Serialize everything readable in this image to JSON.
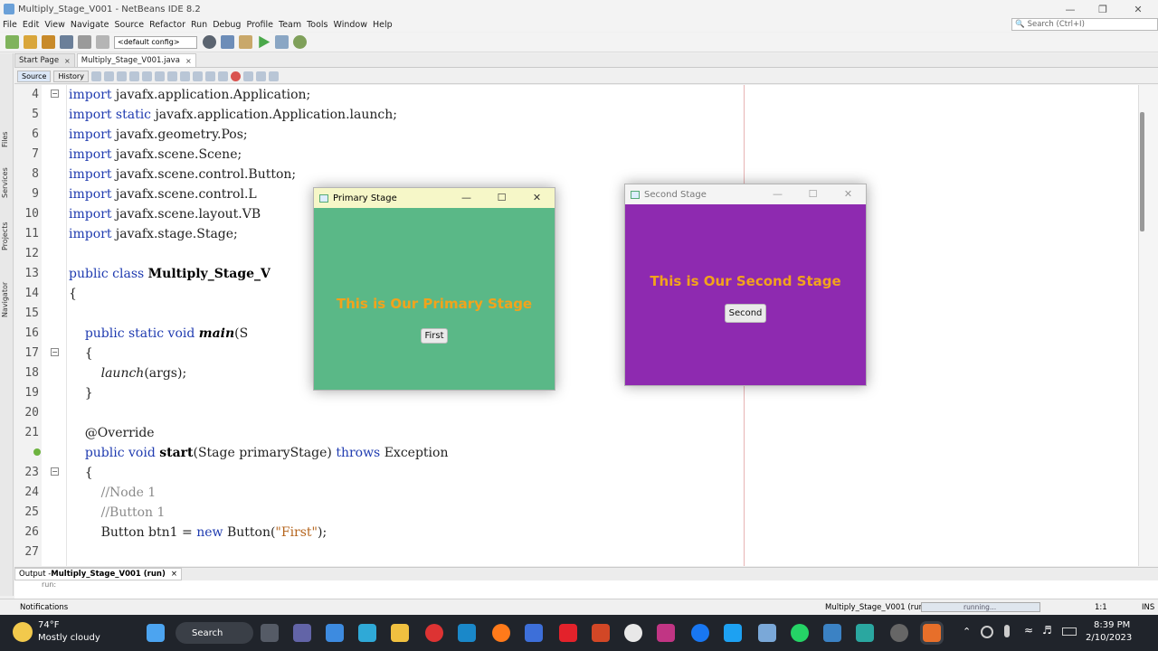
{
  "window": {
    "title": "Multiply_Stage_V001 - NetBeans IDE 8.2"
  },
  "menu": [
    "File",
    "Edit",
    "View",
    "Navigate",
    "Source",
    "Refactor",
    "Run",
    "Debug",
    "Profile",
    "Team",
    "Tools",
    "Window",
    "Help"
  ],
  "search": {
    "placeholder": "Search (Ctrl+I)"
  },
  "toolbar": {
    "config": "<default config>"
  },
  "side_panels": [
    "Files",
    "Services",
    "Projects",
    "Navigator"
  ],
  "tabs": [
    {
      "label": "Start Page",
      "close": "×"
    },
    {
      "label": "Multiply_Stage_V001.java",
      "close": "×"
    }
  ],
  "editor_tabs": {
    "source": "Source",
    "history": "History"
  },
  "code_lines": [
    {
      "n": "4",
      "parts": [
        [
          "kw",
          "import "
        ],
        [
          "",
          "javafx.application.Application;"
        ]
      ]
    },
    {
      "n": "5",
      "parts": [
        [
          "kw",
          "import static "
        ],
        [
          "",
          "javafx.application.Application.launch;"
        ]
      ]
    },
    {
      "n": "6",
      "parts": [
        [
          "kw",
          "import "
        ],
        [
          "",
          "javafx.geometry.Pos;"
        ]
      ]
    },
    {
      "n": "7",
      "parts": [
        [
          "kw",
          "import "
        ],
        [
          "",
          "javafx.scene.Scene;"
        ]
      ]
    },
    {
      "n": "8",
      "parts": [
        [
          "kw",
          "import "
        ],
        [
          "",
          "javafx.scene.control.Button;"
        ]
      ]
    },
    {
      "n": "9",
      "parts": [
        [
          "kw",
          "import "
        ],
        [
          "",
          "javafx.scene.control.L"
        ]
      ]
    },
    {
      "n": "10",
      "parts": [
        [
          "kw",
          "import "
        ],
        [
          "",
          "javafx.scene.layout.VB"
        ]
      ]
    },
    {
      "n": "11",
      "parts": [
        [
          "kw",
          "import "
        ],
        [
          "",
          "javafx.stage.Stage;"
        ]
      ]
    },
    {
      "n": "12",
      "parts": []
    },
    {
      "n": "13",
      "parts": [
        [
          "kw",
          "public class "
        ],
        [
          "b",
          "Multiply_Stage_V"
        ]
      ]
    },
    {
      "n": "14",
      "parts": [
        [
          "",
          "{"
        ]
      ]
    },
    {
      "n": "15",
      "parts": []
    },
    {
      "n": "16",
      "parts": [
        [
          "",
          "    "
        ],
        [
          "kw",
          "public static void "
        ],
        [
          "b it",
          "main"
        ],
        [
          "",
          "(S"
        ]
      ]
    },
    {
      "n": "17",
      "parts": [
        [
          "",
          "    {"
        ]
      ]
    },
    {
      "n": "18",
      "parts": [
        [
          "",
          "        "
        ],
        [
          "it",
          "launch"
        ],
        [
          "",
          "(args);"
        ]
      ]
    },
    {
      "n": "19",
      "parts": [
        [
          "",
          "    }"
        ]
      ]
    },
    {
      "n": "20",
      "parts": []
    },
    {
      "n": "21",
      "parts": [
        [
          "",
          "    @Override"
        ]
      ]
    },
    {
      "n": "",
      "parts": [
        [
          "",
          "    "
        ],
        [
          "kw",
          "public void "
        ],
        [
          "b",
          "start"
        ],
        [
          "",
          "(Stage primaryStage) "
        ],
        [
          "kw",
          "throws "
        ],
        [
          "",
          "Exception"
        ]
      ]
    },
    {
      "n": "23",
      "parts": [
        [
          "",
          "    {"
        ]
      ]
    },
    {
      "n": "24",
      "parts": [
        [
          "",
          "        "
        ],
        [
          "cm",
          "//Node 1"
        ]
      ]
    },
    {
      "n": "25",
      "parts": [
        [
          "",
          "        "
        ],
        [
          "cm",
          "//Button 1"
        ]
      ]
    },
    {
      "n": "26",
      "parts": [
        [
          "",
          "        Button btn1 = "
        ],
        [
          "kw",
          "new "
        ],
        [
          "",
          "Button("
        ],
        [
          "str",
          "\"First\""
        ],
        [
          "",
          ");"
        ]
      ]
    },
    {
      "n": "27",
      "parts": []
    }
  ],
  "output": {
    "label": "Output - ",
    "project": "Multiply_Stage_V001 (run)",
    "close": "×",
    "text": "run:"
  },
  "status": {
    "notifications": "Notifications",
    "running_project": "Multiply_Stage_V001 (run)",
    "progress": "running...",
    "position": "1:1",
    "mode": "INS"
  },
  "primary_stage": {
    "title": "Primary Stage",
    "heading": "This is Our Primary Stage",
    "button": "First",
    "bg": "#5ab887"
  },
  "second_stage": {
    "title": "Second Stage",
    "heading": "This is Our Second Stage",
    "button": "Second",
    "bg": "#8e2ab0"
  },
  "taskbar": {
    "temp": "74°F",
    "weather": "Mostly cloudy",
    "search": "Search",
    "time": "8:39 PM",
    "date": "2/10/2023"
  },
  "colors": {
    "keyword": "#1f3bb0",
    "heading": "#f2a31c"
  }
}
